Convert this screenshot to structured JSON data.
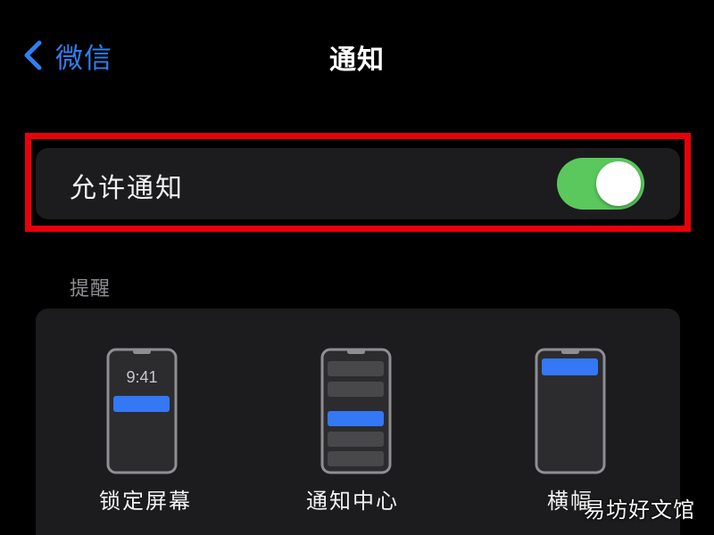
{
  "nav": {
    "back_label": "微信",
    "title": "通知",
    "back_icon": "chevron-left-icon"
  },
  "allow_notifications": {
    "label": "允许通知",
    "enabled": true,
    "toggle_color": "#5ac85d"
  },
  "alerts": {
    "header": "提醒",
    "options": [
      {
        "label": "锁定屏幕",
        "preview_time": "9:41"
      },
      {
        "label": "通知中心"
      },
      {
        "label": "横幅"
      }
    ],
    "accent_color": "#3478f6"
  },
  "highlight_color": "#e8000b",
  "watermark": "易坊好文馆"
}
